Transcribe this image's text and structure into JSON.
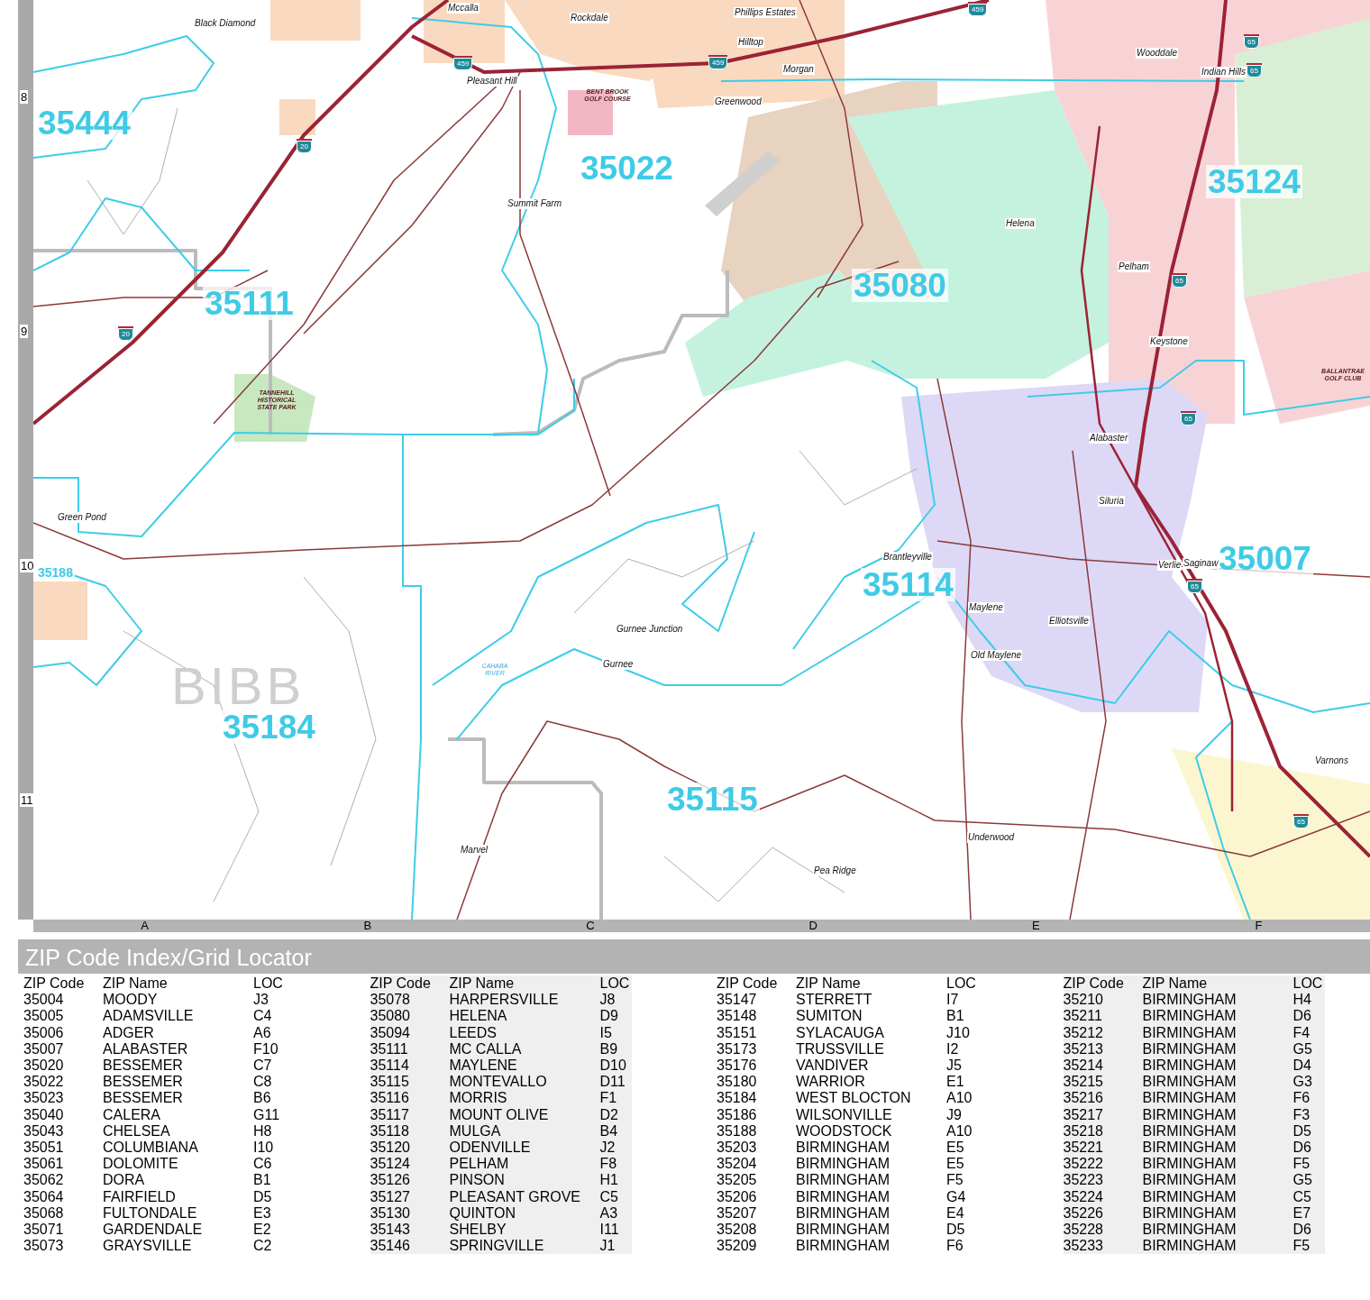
{
  "map": {
    "row_labels": [
      "8",
      "9",
      "10",
      "11"
    ],
    "column_labels": [
      "A",
      "B",
      "C",
      "D",
      "E",
      "F"
    ],
    "county_label": "BIBB",
    "zip_labels": [
      "35444",
      "35022",
      "35124",
      "35111",
      "35080",
      "35114",
      "35007",
      "35184",
      "35115"
    ],
    "inset_zip_labels": [
      "35188"
    ],
    "places": [
      "Black Diamond",
      "Mccalla",
      "Rockdale",
      "Phillips Estates",
      "Hilltop",
      "Morgan",
      "Greenwood",
      "Pleasant Hill",
      "Summit Farm",
      "Helena",
      "Wooddale",
      "Indian Hills",
      "Pelham",
      "Keystone",
      "Alabaster",
      "Siluria",
      "Green Pond",
      "Brantleyville",
      "Verlie",
      "Saginaw",
      "Maylene",
      "Elliotsville",
      "Old Maylene",
      "Gurnee Junction",
      "Gurnee",
      "Marvel",
      "Underwood",
      "Pea Ridge",
      "Varnons"
    ],
    "landmarks": [
      {
        "text": "BENT BROOK GOLF COURSE",
        "kind": "park"
      },
      {
        "text": "TANNEHILL HISTORICAL STATE PARK",
        "kind": "park"
      },
      {
        "text": "BALLANTRAE GOLF CLUB",
        "kind": "park"
      },
      {
        "text": "CAHABA RIVER",
        "kind": "water"
      }
    ],
    "shields": [
      {
        "kind": "interstate",
        "number": "20"
      },
      {
        "kind": "interstate",
        "number": "20"
      },
      {
        "kind": "interstate",
        "number": "459"
      },
      {
        "kind": "interstate",
        "number": "459"
      },
      {
        "kind": "interstate",
        "number": "459"
      },
      {
        "kind": "interstate",
        "number": "65"
      },
      {
        "kind": "interstate",
        "number": "65"
      },
      {
        "kind": "interstate",
        "number": "65"
      },
      {
        "kind": "interstate",
        "number": "65"
      },
      {
        "kind": "interstate",
        "number": "65"
      },
      {
        "kind": "interstate",
        "number": "65"
      }
    ]
  },
  "zip_index": {
    "title": "ZIP Code Index/Grid Locator",
    "groups": [
      {
        "columns": [
          "ZIP Code",
          "ZIP Name",
          "LOC"
        ],
        "rows": [
          [
            "35004",
            "MOODY",
            "J3"
          ],
          [
            "35005",
            "ADAMSVILLE",
            "C4"
          ],
          [
            "35006",
            "ADGER",
            "A6"
          ],
          [
            "35007",
            "ALABASTER",
            "F10"
          ],
          [
            "35020",
            "BESSEMER",
            "C7"
          ],
          [
            "35022",
            "BESSEMER",
            "C8"
          ],
          [
            "35023",
            "BESSEMER",
            "B6"
          ],
          [
            "35040",
            "CALERA",
            "G11"
          ],
          [
            "35043",
            "CHELSEA",
            "H8"
          ],
          [
            "35051",
            "COLUMBIANA",
            "I10"
          ],
          [
            "35061",
            "DOLOMITE",
            "C6"
          ],
          [
            "35062",
            "DORA",
            "B1"
          ],
          [
            "35064",
            "FAIRFIELD",
            "D5"
          ],
          [
            "35068",
            "FULTONDALE",
            "E3"
          ],
          [
            "35071",
            "GARDENDALE",
            "E2"
          ],
          [
            "35073",
            "GRAYSVILLE",
            "C2"
          ]
        ]
      },
      {
        "columns": [
          "ZIP Code",
          "ZIP Name",
          "LOC"
        ],
        "rows": [
          [
            "35078",
            "HARPERSVILLE",
            "J8"
          ],
          [
            "35080",
            "HELENA",
            "D9"
          ],
          [
            "35094",
            "LEEDS",
            "I5"
          ],
          [
            "35111",
            "MC CALLA",
            "B9"
          ],
          [
            "35114",
            "MAYLENE",
            "D10"
          ],
          [
            "35115",
            "MONTEVALLO",
            "D11"
          ],
          [
            "35116",
            "MORRIS",
            "F1"
          ],
          [
            "35117",
            "MOUNT OLIVE",
            "D2"
          ],
          [
            "35118",
            "MULGA",
            "B4"
          ],
          [
            "35120",
            "ODENVILLE",
            "J2"
          ],
          [
            "35124",
            "PELHAM",
            "F8"
          ],
          [
            "35126",
            "PINSON",
            "H1"
          ],
          [
            "35127",
            "PLEASANT GROVE",
            "C5"
          ],
          [
            "35130",
            "QUINTON",
            "A3"
          ],
          [
            "35143",
            "SHELBY",
            "I11"
          ],
          [
            "35146",
            "SPRINGVILLE",
            "J1"
          ]
        ]
      },
      {
        "columns": [
          "ZIP Code",
          "ZIP Name",
          "LOC"
        ],
        "rows": [
          [
            "35147",
            "STERRETT",
            "I7"
          ],
          [
            "35148",
            "SUMITON",
            "B1"
          ],
          [
            "35151",
            "SYLACAUGA",
            "J10"
          ],
          [
            "35173",
            "TRUSSVILLE",
            "I2"
          ],
          [
            "35176",
            "VANDIVER",
            "J5"
          ],
          [
            "35180",
            "WARRIOR",
            "E1"
          ],
          [
            "35184",
            "WEST BLOCTON",
            "A10"
          ],
          [
            "35186",
            "WILSONVILLE",
            "J9"
          ],
          [
            "35188",
            "WOODSTOCK",
            "A10"
          ],
          [
            "35203",
            "BIRMINGHAM",
            "E5"
          ],
          [
            "35204",
            "BIRMINGHAM",
            "E5"
          ],
          [
            "35205",
            "BIRMINGHAM",
            "F5"
          ],
          [
            "35206",
            "BIRMINGHAM",
            "G4"
          ],
          [
            "35207",
            "BIRMINGHAM",
            "E4"
          ],
          [
            "35208",
            "BIRMINGHAM",
            "D5"
          ],
          [
            "35209",
            "BIRMINGHAM",
            "F6"
          ]
        ]
      },
      {
        "columns": [
          "ZIP Code",
          "ZIP Name",
          "LOC"
        ],
        "rows": [
          [
            "35210",
            "BIRMINGHAM",
            "H4"
          ],
          [
            "35211",
            "BIRMINGHAM",
            "D6"
          ],
          [
            "35212",
            "BIRMINGHAM",
            "F4"
          ],
          [
            "35213",
            "BIRMINGHAM",
            "G5"
          ],
          [
            "35214",
            "BIRMINGHAM",
            "D4"
          ],
          [
            "35215",
            "BIRMINGHAM",
            "G3"
          ],
          [
            "35216",
            "BIRMINGHAM",
            "F6"
          ],
          [
            "35217",
            "BIRMINGHAM",
            "F3"
          ],
          [
            "35218",
            "BIRMINGHAM",
            "D5"
          ],
          [
            "35221",
            "BIRMINGHAM",
            "D6"
          ],
          [
            "35222",
            "BIRMINGHAM",
            "F5"
          ],
          [
            "35223",
            "BIRMINGHAM",
            "G5"
          ],
          [
            "35224",
            "BIRMINGHAM",
            "C5"
          ],
          [
            "35226",
            "BIRMINGHAM",
            "E7"
          ],
          [
            "35228",
            "BIRMINGHAM",
            "D6"
          ],
          [
            "35233",
            "BIRMINGHAM",
            "F5"
          ]
        ]
      }
    ]
  }
}
